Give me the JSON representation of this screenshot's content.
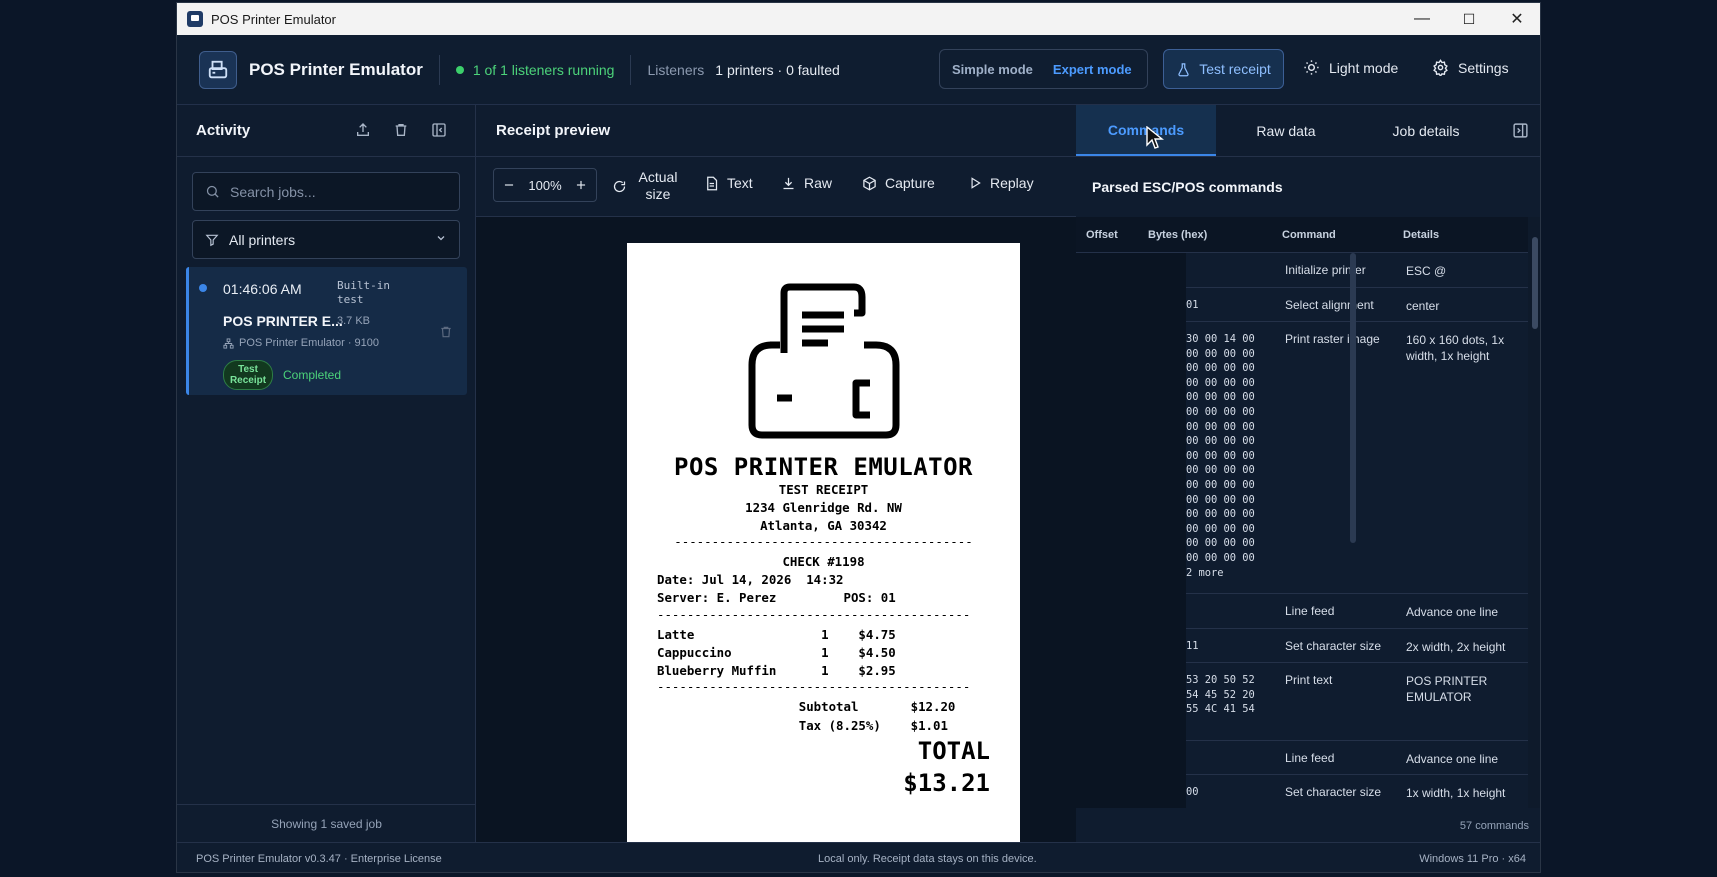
{
  "window": {
    "title": "POS Printer Emulator",
    "minimize": "—",
    "maximize": "☐",
    "close": "✕"
  },
  "header": {
    "brand": "POS Printer Emulator",
    "listeners_status": "1 of 1 listeners running",
    "listeners_label": "Listeners",
    "listeners_value": "1 printers · 0 faulted",
    "mode_simple": "Simple mode",
    "mode_expert": "Expert mode",
    "active_mode": "Expert mode",
    "test_receipt": "Test receipt",
    "light_mode": "Light mode",
    "settings": "Settings"
  },
  "sidebar": {
    "title": "Activity",
    "search_placeholder": "Search jobs...",
    "filter": "All printers",
    "job": {
      "time": "01:46:06 AM",
      "source": "Built-in test",
      "name": "POS PRINTER E...",
      "size": "3.7 KB",
      "port": "POS Printer Emulator · 9100",
      "badge": "Test Receipt",
      "status": "Completed"
    },
    "footer": "Showing 1 saved job"
  },
  "preview": {
    "title": "Receipt preview",
    "zoom": "100%",
    "actual_size": "Actual size",
    "text_btn": "Text",
    "raw_btn": "Raw",
    "capture_btn": "Capture",
    "replay_btn": "Replay"
  },
  "receipt": {
    "title": "POS PRINTER EMULATOR",
    "subtitle": "TEST RECEIPT",
    "addr1": "1234 Glenridge Rd. NW",
    "addr2": "Atlanta, GA 30342",
    "sep1": "----------------------------------------",
    "check": "CHECK #1198",
    "date": "Date: Jul 14, 2026  14:32",
    "server": "Server: E. Perez         POS: 01",
    "sep2": "------------------------------------------",
    "item1": "Latte                 1    $4.75",
    "item2": "Cappuccino            1    $4.50",
    "item3": "Blueberry Muffin      1    $2.95",
    "sep3": "------------------------------------------",
    "subtotal": "                   Subtotal       $12.20",
    "tax": "                   Tax (8.25%)    $1.01",
    "total_label": "TOTAL",
    "total_value": "$13.21"
  },
  "right_panel": {
    "tabs": [
      "Commands",
      "Raw data",
      "Job details"
    ],
    "active_tab": "Commands",
    "title": "Parsed ESC/POS commands",
    "columns": [
      "Offset",
      "Bytes (hex)",
      "Command",
      "Details"
    ],
    "rows": [
      {
        "hex": "",
        "command": "Initialize printer",
        "details": "ESC @"
      },
      {
        "hex": "01",
        "command": "Select alignment",
        "details": "center"
      },
      {
        "hex": "30 00 14 00\n00 00 00 00\n00 00 00 00\n00 00 00 00\n00 00 00 00\n00 00 00 00\n00 00 00 00\n00 00 00 00\n00 00 00 00\n00 00 00 00\n00 00 00 00\n00 00 00 00\n00 00 00 00\n00 00 00 00\n00 00 00 00\n00 00 00 00\n2 more",
        "command": "Print raster image",
        "details": "160 x 160 dots, 1x width, 1x height"
      },
      {
        "hex": "",
        "command": "Line feed",
        "details": "Advance one line"
      },
      {
        "hex": "11",
        "command": "Set character size",
        "details": "2x width, 2x height"
      },
      {
        "hex": "53 20 50 52\n54 45 52 20\n55 4C 41 54",
        "command": "Print text",
        "details": "POS PRINTER EMULATOR"
      },
      {
        "hex": "",
        "command": "Line feed",
        "details": "Advance one line"
      },
      {
        "hex": "00",
        "command": "Set character size",
        "details": "1x width, 1x height"
      }
    ],
    "count": "57 commands"
  },
  "statusbar": {
    "left": "POS Printer Emulator v0.3.47 · Enterprise License",
    "center": "Local only. Receipt data stays on this device.",
    "right": "Windows 11 Pro · x64"
  },
  "colors": {
    "accent": "#3b86e8",
    "success": "#4cd37a",
    "background": "#0e1a2b"
  }
}
